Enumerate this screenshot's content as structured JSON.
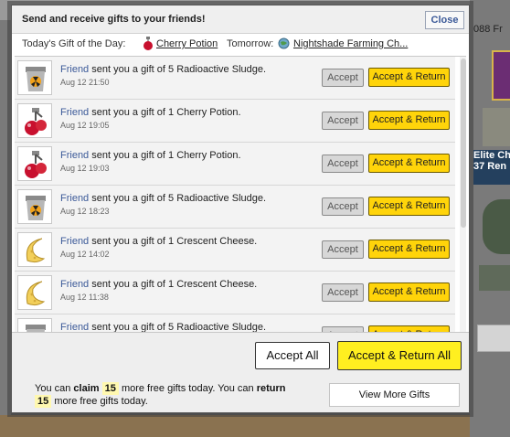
{
  "dialog": {
    "title": "Send and receive gifts to your friends!",
    "close_label": "Close",
    "today_label": "Today's Gift of the Day:",
    "today_gift": "Cherry Potion",
    "tomorrow_label": "Tomorrow:",
    "tomorrow_gift": "Nightshade Farming Ch..."
  },
  "gifts": [
    {
      "sender": "Friend",
      "message": "sent you a gift of 5 Radioactive Sludge.",
      "date": "Aug 12 21:50",
      "icon": "radioactive-sludge-icon",
      "accept_label": "Accept",
      "accept_return_label": "Accept & Return"
    },
    {
      "sender": "Friend",
      "message": "sent you a gift of 1 Cherry Potion.",
      "date": "Aug 12 19:05",
      "icon": "cherry-potion-icon",
      "accept_label": "Accept",
      "accept_return_label": "Accept & Return"
    },
    {
      "sender": "Friend",
      "message": "sent you a gift of 1 Cherry Potion.",
      "date": "Aug 12 19:03",
      "icon": "cherry-potion-icon",
      "accept_label": "Accept",
      "accept_return_label": "Accept & Return"
    },
    {
      "sender": "Friend",
      "message": "sent you a gift of 5 Radioactive Sludge.",
      "date": "Aug 12 18:23",
      "icon": "radioactive-sludge-icon",
      "accept_label": "Accept",
      "accept_return_label": "Accept & Return"
    },
    {
      "sender": "Friend",
      "message": "sent you a gift of 1 Crescent Cheese.",
      "date": "Aug 12 14:02",
      "icon": "crescent-cheese-icon",
      "accept_label": "Accept",
      "accept_return_label": "Accept & Return"
    },
    {
      "sender": "Friend",
      "message": "sent you a gift of 1 Crescent Cheese.",
      "date": "Aug 12 11:38",
      "icon": "crescent-cheese-icon",
      "accept_label": "Accept",
      "accept_return_label": "Accept & Return"
    },
    {
      "sender": "Friend",
      "message": "sent you a gift of 5 Radioactive Sludge.",
      "date": "",
      "icon": "radioactive-sludge-icon",
      "accept_label": "Accept",
      "accept_return_label": "Accept & Return"
    }
  ],
  "footer": {
    "accept_all_label": "Accept All",
    "accept_return_all_label": "Accept & Return All",
    "info_prefix": "You can",
    "claim_word": "claim",
    "claim_count": "15",
    "info_mid": "more free gifts today. You can",
    "return_word": "return",
    "return_count": "15",
    "info_suffix": "more free gifts today.",
    "view_more_label": "View More Gifts"
  },
  "background": {
    "top_right_text": "088  Fr",
    "elite_line1": "Elite Ch",
    "elite_line2": "37 Ren"
  },
  "colors": {
    "link": "#3b5998",
    "accept_return": "#ffd40a",
    "accept_return_all": "#ffef20",
    "highlight": "#fff8b0"
  }
}
